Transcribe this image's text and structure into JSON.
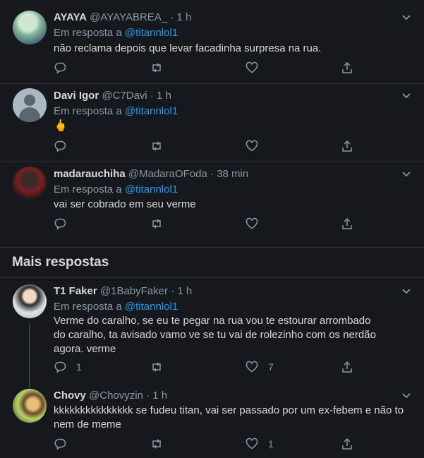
{
  "tweets": [
    {
      "name": "AYAYA",
      "handle": "@AYAYABREA_",
      "time": "1 h",
      "reply_prefix": "Em resposta a",
      "reply_to": "@titannlol1",
      "text": "não reclama depois que levar facadinha surpresa na rua.",
      "replies": "",
      "likes": ""
    },
    {
      "name": "Davi Igor",
      "handle": "@C7Davi",
      "time": "1 h",
      "reply_prefix": "Em resposta a",
      "reply_to": "@titannlol1",
      "text": "🖕",
      "replies": "",
      "likes": ""
    },
    {
      "name": "madarauchiha",
      "handle": "@MadaraOFoda",
      "time": "38 min",
      "reply_prefix": "Em resposta a",
      "reply_to": "@titannlol1",
      "text": "vai ser cobrado em seu verme",
      "replies": "",
      "likes": ""
    },
    {
      "name": "T1 Faker",
      "handle": "@1BabyFaker",
      "time": "1 h",
      "reply_prefix": "Em resposta a",
      "reply_to": "@titannlol1",
      "text": "Verme do caralho, se eu te pegar na rua vou te estourar arrombado do caralho, ta avisado vamo ve se tu vai de rolezinho com os nerdão agora. verme",
      "replies": "1",
      "likes": "7"
    },
    {
      "name": "Chovy",
      "handle": "@Chovyzin",
      "time": "1 h",
      "reply_prefix": "",
      "reply_to": "",
      "text": "kkkkkkkkkkkkkkk se fudeu titan, vai ser passado por um ex-febem e não to nem de meme",
      "replies": "",
      "likes": "1"
    }
  ],
  "section": {
    "title": "Mais respostas"
  },
  "colors": {
    "background": "#15181c",
    "link": "#1d9bf0",
    "muted": "#8b98a5",
    "text": "#d9d9d9"
  },
  "icons": [
    "reply-icon",
    "retweet-icon",
    "like-icon",
    "share-icon",
    "caret-down-icon",
    "middle-finger-emoji"
  ]
}
